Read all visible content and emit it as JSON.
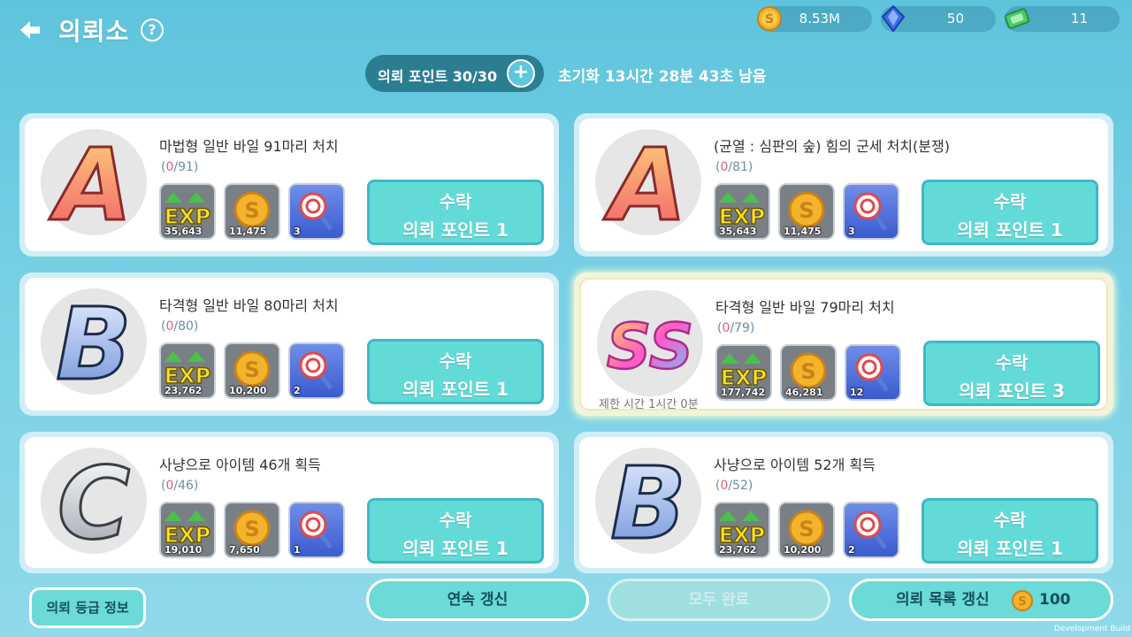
{
  "header": {
    "title": "의뢰소",
    "help_label": "?"
  },
  "currencies": {
    "gold": "8.53M",
    "gem": "50",
    "cash": "11"
  },
  "points": {
    "label": "의뢰 포인트 30/30",
    "plus_label": "+",
    "reset_text": "초기화 13시간 28분 43초 남음"
  },
  "quests": [
    {
      "grade": "A",
      "title": "마법형 일반 바일 91마리 처치",
      "progress_current": "0",
      "progress_total": "/91",
      "exp": "35,643",
      "gold": "11,475",
      "item": "3",
      "accept_l1": "수락",
      "accept_l2": "의뢰 포인트 1",
      "time_limit": ""
    },
    {
      "grade": "A",
      "title": "(균열 : 심판의 숲) 힘의 군세 처치(분쟁)",
      "progress_current": "0",
      "progress_total": "/81",
      "exp": "35,643",
      "gold": "11,475",
      "item": "3",
      "accept_l1": "수락",
      "accept_l2": "의뢰 포인트 1",
      "time_limit": ""
    },
    {
      "grade": "B",
      "title": "타격형 일반 바일 80마리 처치",
      "progress_current": "0",
      "progress_total": "/80",
      "exp": "23,762",
      "gold": "10,200",
      "item": "2",
      "accept_l1": "수락",
      "accept_l2": "의뢰 포인트 1",
      "time_limit": ""
    },
    {
      "grade": "SS",
      "title": "타격형 일반 바일 79마리 처치",
      "progress_current": "0",
      "progress_total": "/79",
      "exp": "177,742",
      "gold": "46,281",
      "item": "12",
      "accept_l1": "수락",
      "accept_l2": "의뢰 포인트 3",
      "time_limit": "제한 시간 1시간 0분"
    },
    {
      "grade": "C",
      "title": "사냥으로 아이템 46개 획득",
      "progress_current": "0",
      "progress_total": "/46",
      "exp": "19,010",
      "gold": "7,650",
      "item": "1",
      "accept_l1": "수락",
      "accept_l2": "의뢰 포인트 1",
      "time_limit": ""
    },
    {
      "grade": "B",
      "title": "사냥으로 아이템 52개 획득",
      "progress_current": "0",
      "progress_total": "/52",
      "exp": "23,762",
      "gold": "10,200",
      "item": "2",
      "accept_l1": "수락",
      "accept_l2": "의뢰 포인트 1",
      "time_limit": ""
    }
  ],
  "reward_exp_label": "EXP",
  "footer": {
    "grade_info": "의뢰 등급 정보",
    "continuous_refresh": "연속 갱신",
    "complete_all": "모두 완료",
    "refresh_list": "의뢰 목록 갱신",
    "refresh_cost": "100",
    "dev_build": "Development Build"
  },
  "colors": {
    "accent": "#62dbd8",
    "progress_current": "#e0607a",
    "background": "#6ccbe0"
  }
}
